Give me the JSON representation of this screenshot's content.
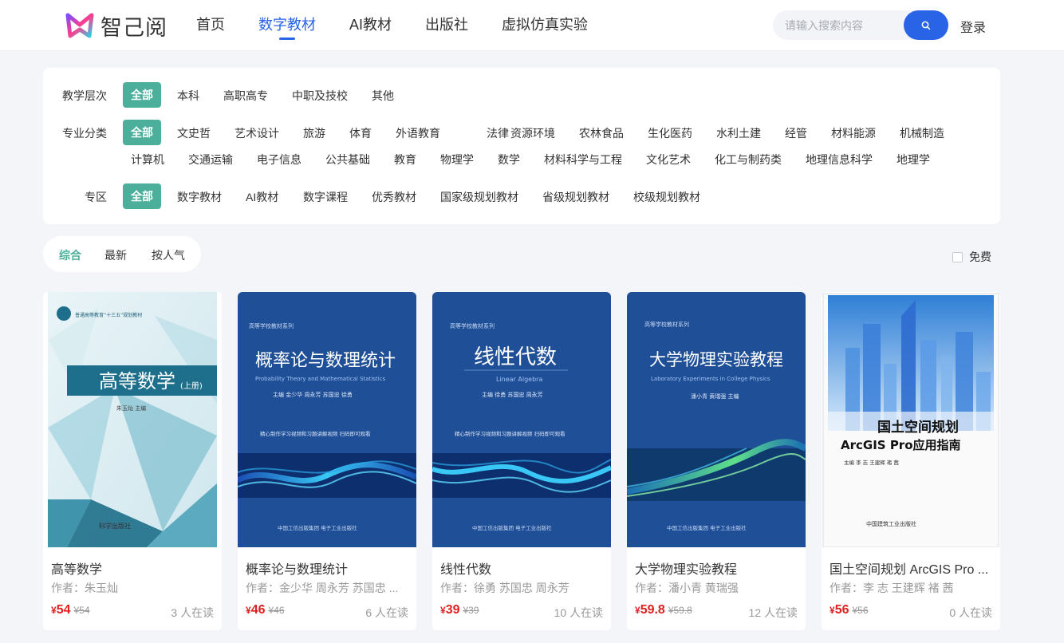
{
  "header": {
    "logo_text": "智己阅",
    "nav": [
      "首页",
      "数字教材",
      "AI教材",
      "出版社",
      "虚拟仿真实验"
    ],
    "active_nav": 1,
    "search_placeholder": "请输入搜索内容",
    "login": "登录",
    "accent": "#2a64e6"
  },
  "filters": {
    "accent": "#4caf9b",
    "level": {
      "label": "教学层次",
      "options": [
        "全部",
        "本科",
        "高职高专",
        "中职及技校",
        "其他"
      ]
    },
    "major": {
      "label": "专业分类",
      "options": [
        "全部",
        "文史哲",
        "艺术设计",
        "旅游",
        "体育",
        "外语教育",
        "法律",
        "资源环境",
        "农林食品",
        "生化医药",
        "水利土建",
        "经管",
        "材料能源",
        "机械制造",
        "计算机",
        "交通运输",
        "电子信息",
        "公共基础",
        "教育",
        "物理学",
        "数学",
        "材料科学与工程",
        "文化艺术",
        "化工与制药类",
        "地理信息科学",
        "地理学"
      ]
    },
    "zone": {
      "label": "专区",
      "options": [
        "全部",
        "数字教材",
        "AI教材",
        "数字课程",
        "优秀教材",
        "国家级规划教材",
        "省级规划教材",
        "校级规划教材"
      ]
    }
  },
  "sort": {
    "options": [
      "综合",
      "最新",
      "按人气"
    ],
    "active": 0,
    "free_label": "免费"
  },
  "books": [
    {
      "title": "高等数学",
      "author": "作者：朱玉灿",
      "currency": "¥",
      "price": "54",
      "original_price": "¥54",
      "readers": "3 人在读",
      "cover": {
        "title": "高等数学",
        "subtitle": "(上册)",
        "series": "普通高等教育“十三五”规划教材",
        "author_line": "朱玉灿 主编",
        "publisher": "科学出版社"
      }
    },
    {
      "title": "概率论与数理统计",
      "author": "作者：金少华 周永芳 苏国忠 ...",
      "currency": "¥",
      "price": "46",
      "original_price": "¥46",
      "readers": "6 人在读",
      "cover": {
        "series": "高等学校教材系列",
        "title": "概率论与数理统计",
        "english": "Probability Theory and Mathematical Statistics",
        "authors": "主编  金少华  周永芳  苏国忠  徐勇",
        "note": "精心制作学习视频和习题讲解视频  扫码即可观看",
        "publisher": "中国工信出版集团  电子工业出版社"
      }
    },
    {
      "title": "线性代数",
      "author": "作者：徐勇 苏国忠 周永芳",
      "currency": "¥",
      "price": "39",
      "original_price": "¥39",
      "readers": "10 人在读",
      "cover": {
        "series": "高等学校教材系列",
        "title": "线性代数",
        "english": "Linear Algebra",
        "authors": "主编  徐勇  苏国忠  周永芳",
        "note": "精心制作学习视频和习题讲解视频  扫码即可观看",
        "publisher": "中国工信出版集团  电子工业出版社"
      }
    },
    {
      "title": "大学物理实验教程",
      "author": "作者：潘小青 黄瑞强",
      "currency": "¥",
      "price": "59.8",
      "original_price": "¥59.8",
      "readers": "12 人在读",
      "cover": {
        "series": "高等学校教材系列",
        "title": "大学物理实验教程",
        "english": "Laboratory Experiments in College Physics",
        "authors": "潘小青  黄瑞强  主编",
        "publisher": "中国工信出版集团  电子工业出版社"
      }
    },
    {
      "title": "国土空间规划 ArcGIS Pro ...",
      "author": "作者：李 志 王建辉 褚 茜",
      "currency": "¥",
      "price": "56",
      "original_price": "¥56",
      "readers": "0 人在读",
      "cover": {
        "title1": "国土空间规划",
        "title2": "ArcGIS Pro应用指南",
        "authors": "主编  李 志  王建辉  褚 茜",
        "publisher": "中国建筑工业出版社"
      }
    }
  ]
}
